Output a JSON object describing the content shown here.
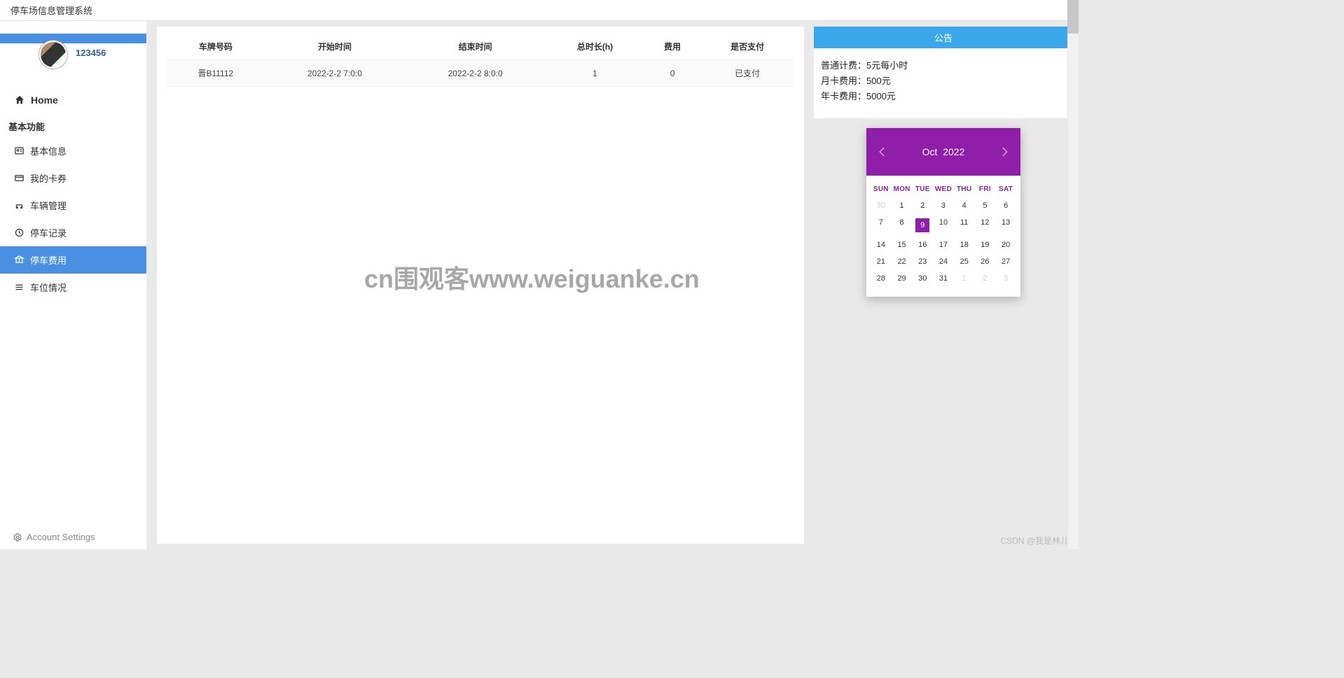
{
  "header": {
    "title": "停车场信息管理系统"
  },
  "user": {
    "name": "123456"
  },
  "sidebar": {
    "home": "Home",
    "sectionLabel": "基本功能",
    "items": [
      {
        "label": "基本信息",
        "active": false,
        "icon": "id-card-icon"
      },
      {
        "label": "我的卡券",
        "active": false,
        "icon": "card-icon"
      },
      {
        "label": "车辆管理",
        "active": false,
        "icon": "car-icon"
      },
      {
        "label": "停车记录",
        "active": false,
        "icon": "clock-icon"
      },
      {
        "label": "停车费用",
        "active": true,
        "icon": "bank-icon"
      },
      {
        "label": "车位情况",
        "active": false,
        "icon": "list-icon"
      }
    ],
    "accountSettings": "Account Settings"
  },
  "table": {
    "headers": [
      "车牌号码",
      "开始时间",
      "结束时间",
      "总时长(h)",
      "费用",
      "是否支付"
    ],
    "rows": [
      [
        "晋B11112",
        "2022-2-2 7:0:0",
        "2022-2-2 8:0:0",
        "1",
        "0",
        "已支付"
      ]
    ]
  },
  "announcement": {
    "title": "公告",
    "lines": [
      "普通计费：5元每小时",
      "月卡费用：500元",
      "年卡费用：5000元"
    ]
  },
  "calendar": {
    "month": "Oct",
    "year": "2022",
    "dow": [
      "SUN",
      "MON",
      "TUE",
      "WED",
      "THU",
      "FRI",
      "SAT"
    ],
    "selected": 9,
    "leadingPad": [
      30
    ],
    "days": [
      1,
      2,
      3,
      4,
      5,
      6,
      7,
      8,
      9,
      10,
      11,
      12,
      13,
      14,
      15,
      16,
      17,
      18,
      19,
      20,
      21,
      22,
      23,
      24,
      25,
      26,
      27,
      28,
      29,
      30,
      31
    ],
    "trailingPad": [
      1,
      2,
      3
    ]
  },
  "watermark": "cn围观客www.weiguanke.cn",
  "csdnCredit": "CSDN @我是林儿",
  "colors": {
    "accentBlue": "#4a90e2",
    "headerBlue": "#3aa7ea",
    "calendarPurple": "#8f1fa8"
  }
}
